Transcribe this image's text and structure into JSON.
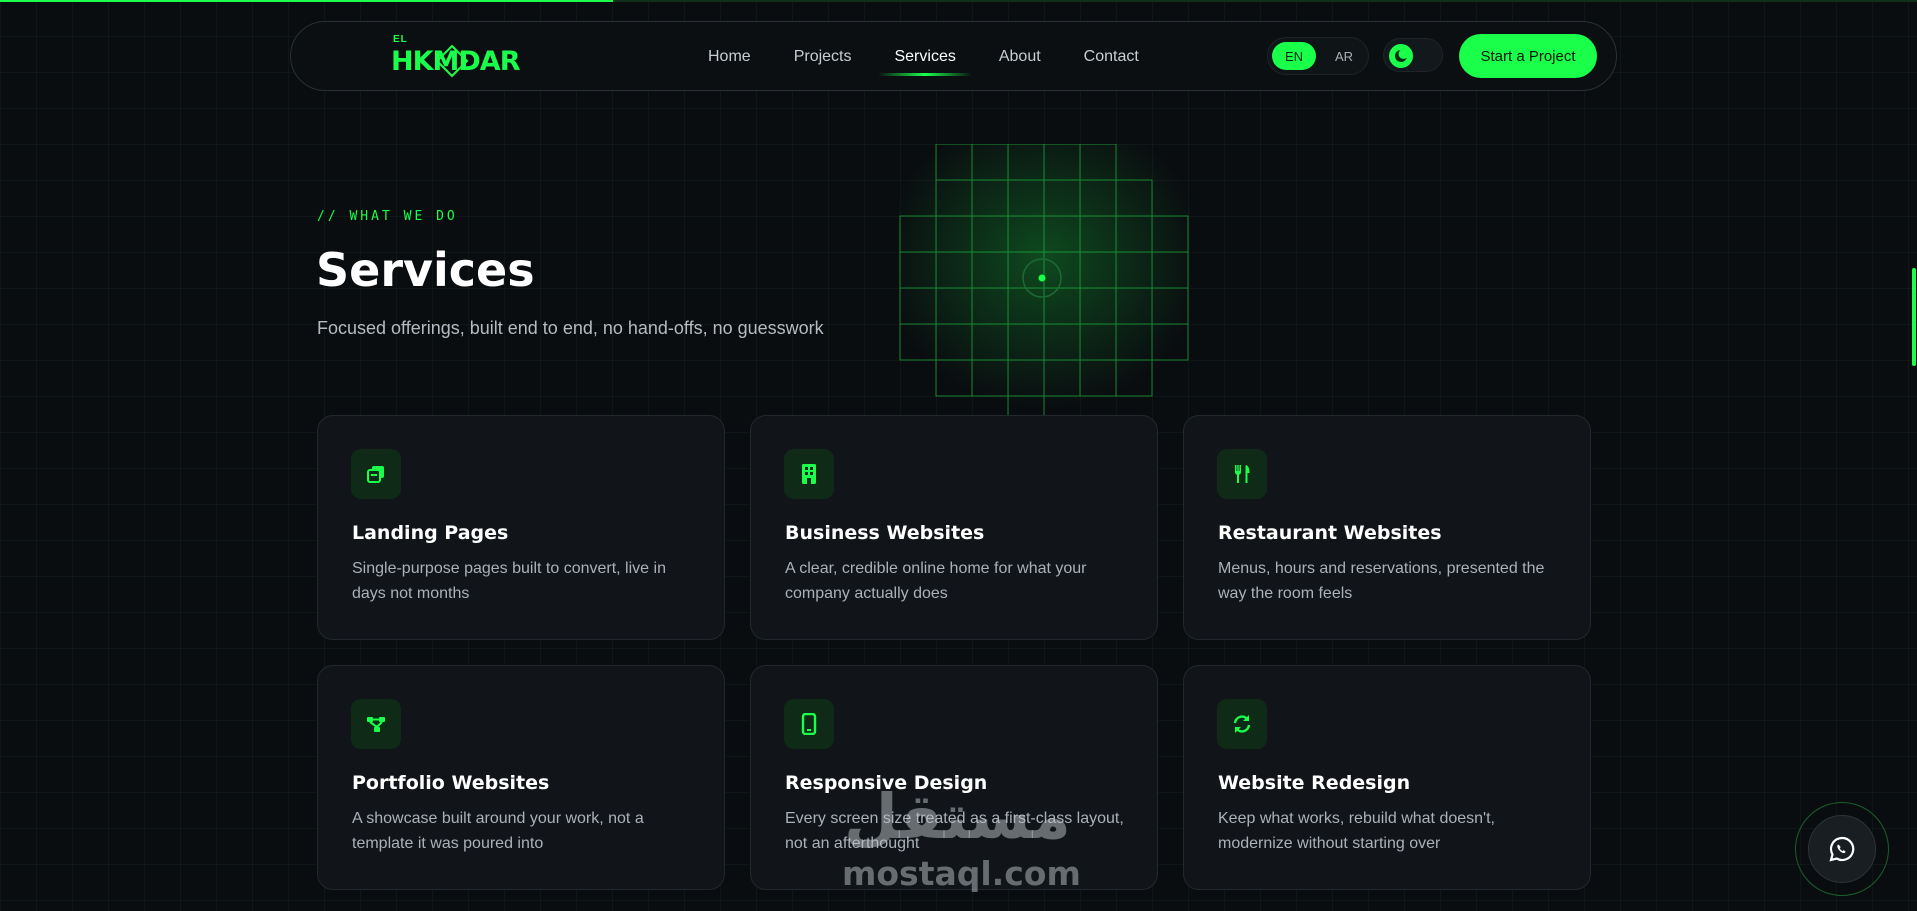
{
  "brand": {
    "logo_small": "EL",
    "logo_main": "HKMDAR",
    "accent": "#19ff4a"
  },
  "nav": {
    "items": [
      {
        "label": "Home"
      },
      {
        "label": "Projects"
      },
      {
        "label": "Services",
        "active": true
      },
      {
        "label": "About"
      },
      {
        "label": "Contact"
      }
    ],
    "lang": {
      "en": "EN",
      "ar": "AR",
      "selected": "EN"
    },
    "theme_icon": "moon-icon",
    "cta_label": "Start a Project"
  },
  "page_progress": 0.32,
  "hero": {
    "eyebrow": "// WHAT WE DO",
    "title": "Services",
    "subtitle": "Focused offerings, built end to end, no hand-offs, no guesswork"
  },
  "services": [
    {
      "icon": "layers-icon",
      "title": "Landing Pages",
      "desc": "Single-purpose pages built to convert, live in days not months"
    },
    {
      "icon": "building-icon",
      "title": "Business Websites",
      "desc": "A clear, credible online home for what your company actually does"
    },
    {
      "icon": "utensils-icon",
      "title": "Restaurant Websites",
      "desc": "Menus, hours and reservations, presented the way the room feels"
    },
    {
      "icon": "nodes-icon",
      "title": "Portfolio Websites",
      "desc": "A showcase built around your work, not a template it was poured into"
    },
    {
      "icon": "mobile-icon",
      "title": "Responsive Design",
      "desc": "Every screen size treated as a first-class layout, not an afterthought"
    },
    {
      "icon": "refresh-icon",
      "title": "Website Redesign",
      "desc": "Keep what works, rebuild what doesn't, modernize without starting over"
    }
  ],
  "watermark": {
    "arabic": "مستقل",
    "latin": "mostaql.com"
  },
  "float_button_icon": "whatsapp-icon"
}
